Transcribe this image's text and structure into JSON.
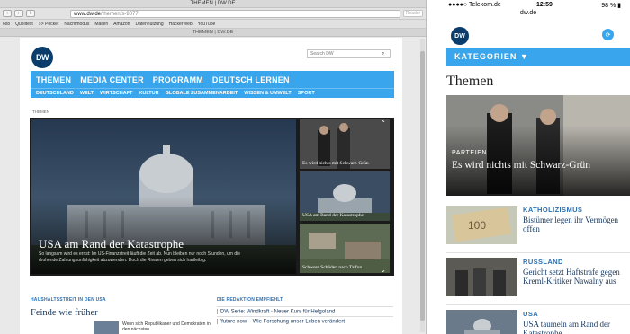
{
  "desktop": {
    "window_title": "THEMEN | DW.DE",
    "url_host": "www.dw.de",
    "url_path": "/themen/s-9077",
    "reader_label": "Reader",
    "bookmarks": [
      "6x8",
      "Quelltext",
      ">> Pocket",
      "Nachtmodus",
      "Mailen",
      "Amazon",
      "Datennutzung",
      "HackerWeb",
      "YouTube"
    ],
    "tab_title": "THEMEN | DW.DE",
    "logo_text": "DW",
    "search_placeholder": "Search DW",
    "main_nav": [
      "THEMEN",
      "MEDIA CENTER",
      "PROGRAMM",
      "DEUTSCH LERNEN"
    ],
    "sub_nav": [
      "DEUTSCHLAND",
      "WELT",
      "WIRTSCHAFT",
      "KULTUR",
      "GLOBALE ZUSAMMENARBEIT",
      "WISSEN & UMWELT",
      "SPORT"
    ],
    "breadcrumb": "THEMEN",
    "hero": {
      "title": "USA am Rand der Katastrophe",
      "text": "So langsam wird es ernst: Im US-Finanzstreit läuft die Zeit ab. Nun bleiben nur noch Stunden, um die drohende Zahlungsunfähigkeit abzuwenden. Doch die Rivalen geben sich hartleibig."
    },
    "thumbs": [
      {
        "caption": "Es wird nichts mit Schwarz-Grün"
      },
      {
        "caption": "USA am Rand der Katastrophe"
      },
      {
        "caption": "Schwere Schäden nach Taifun"
      }
    ],
    "section_left": {
      "label": "HAUSHALTSSTREIT IN DEN USA",
      "title": "Feinde wie früher",
      "text": "Wenn sich Republikaner und Demokraten in den nächsten"
    },
    "section_right": {
      "label": "DIE REDAKTION EMPFIEHLT",
      "links": [
        "DW Serie: Windkraft - Neuer Kurs für Helgoland",
        "'future now' - Wie Forschung unser Leben verändert"
      ]
    }
  },
  "phone": {
    "carrier": "Telekom.de",
    "time": "12:59",
    "battery": "98 %",
    "domain": "dw.de",
    "logo_text": "DW",
    "categories_label": "KATEGORIEN ▼",
    "heading": "Themen",
    "hero": {
      "category": "PARTEIEN",
      "title": "Es wird nichts mit Schwarz-Grün"
    },
    "items": [
      {
        "category": "KATHOLIZISMUS",
        "title": "Bistümer legen ihr Vermögen offen"
      },
      {
        "category": "RUSSLAND",
        "title": "Gericht setzt Haftstrafe gegen Kreml-Kritiker Nawalny aus"
      },
      {
        "category": "USA",
        "title": "USA taumeln am Rand der Katastrophe"
      }
    ]
  }
}
